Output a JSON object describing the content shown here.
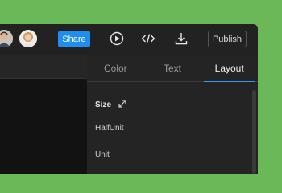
{
  "header": {
    "avatars": [
      {
        "icon": "user-avatar-man"
      },
      {
        "icon": "user-avatar-woman"
      }
    ],
    "share_label": "Share",
    "icons": [
      "play-icon",
      "code-icon",
      "download-icon"
    ],
    "publish_label": "Publish",
    "accent_color": "#1e8ef0"
  },
  "panel": {
    "tabs": [
      {
        "label": "Color",
        "active": false
      },
      {
        "label": "Text",
        "active": false
      },
      {
        "label": "Layout",
        "active": true
      }
    ],
    "section": {
      "label": "Size",
      "icon": "expand-icon"
    },
    "options": [
      "HalfUnit",
      "Unit"
    ]
  }
}
